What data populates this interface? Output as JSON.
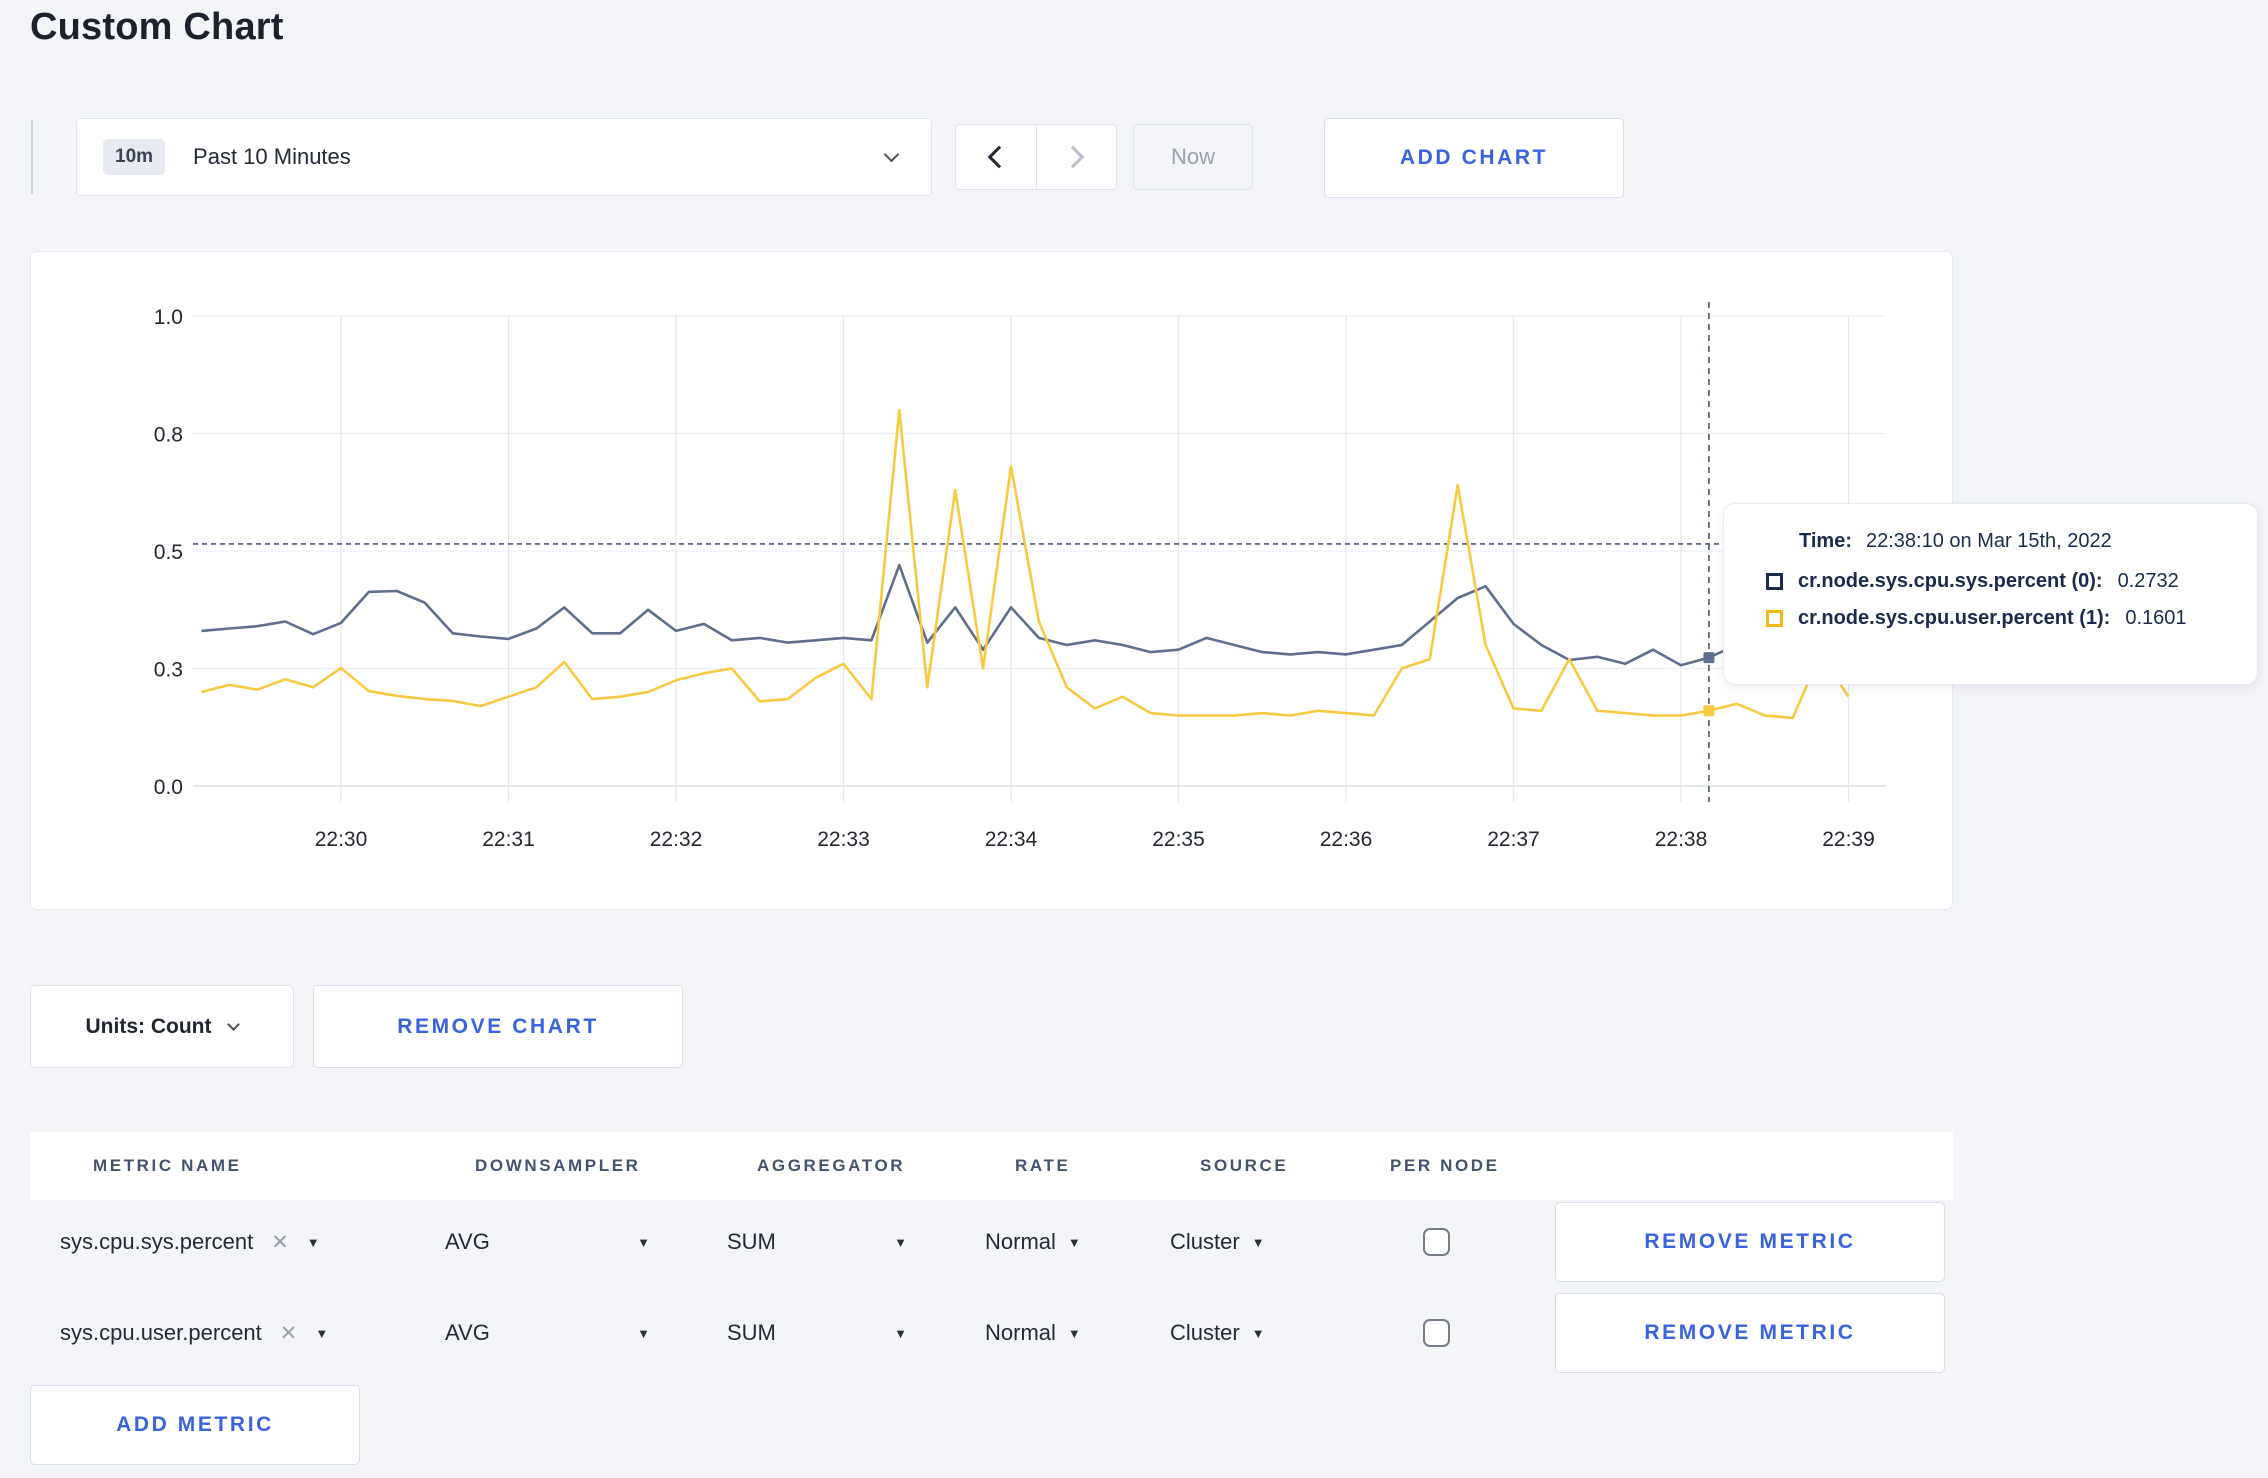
{
  "page": {
    "title": "Custom Chart"
  },
  "toolbar": {
    "range_badge": "10m",
    "range_label": "Past 10 Minutes",
    "now_label": "Now",
    "add_chart_label": "ADD CHART"
  },
  "chart_data": {
    "type": "line",
    "ylim": [
      0,
      1
    ],
    "grid": true,
    "yticks": [
      {
        "label": "0.0",
        "pos": 0
      },
      {
        "label": "0.3",
        "pos": 0.25
      },
      {
        "label": "0.5",
        "pos": 0.5
      },
      {
        "label": "0.8",
        "pos": 0.75
      },
      {
        "label": "1.0",
        "pos": 1
      }
    ],
    "x_axis": {
      "start_tick": "22:30:00",
      "tick_interval_minutes": 1,
      "tick_labels": [
        "22:30",
        "22:31",
        "22:32",
        "22:33",
        "22:34",
        "22:35",
        "22:36",
        "22:37",
        "22:38",
        "22:39"
      ]
    },
    "times": [
      "22:29:10",
      "22:29:20",
      "22:29:30",
      "22:29:40",
      "22:29:50",
      "22:30:00",
      "22:30:10",
      "22:30:20",
      "22:30:30",
      "22:30:40",
      "22:30:50",
      "22:31:00",
      "22:31:10",
      "22:31:20",
      "22:31:30",
      "22:31:40",
      "22:31:50",
      "22:32:00",
      "22:32:10",
      "22:32:20",
      "22:32:30",
      "22:32:40",
      "22:32:50",
      "22:33:00",
      "22:33:10",
      "22:33:20",
      "22:33:30",
      "22:33:40",
      "22:33:50",
      "22:34:00",
      "22:34:10",
      "22:34:20",
      "22:34:30",
      "22:34:40",
      "22:34:50",
      "22:35:00",
      "22:35:10",
      "22:35:20",
      "22:35:30",
      "22:35:40",
      "22:35:50",
      "22:36:00",
      "22:36:10",
      "22:36:20",
      "22:36:30",
      "22:36:40",
      "22:36:50",
      "22:37:00",
      "22:37:10",
      "22:37:20",
      "22:37:30",
      "22:37:40",
      "22:37:50",
      "22:38:00",
      "22:38:10",
      "22:38:20",
      "22:38:30",
      "22:38:40",
      "22:38:50",
      "22:39:00"
    ],
    "series": [
      {
        "name": "cr.node.sys.cpu.sys.percent",
        "node": "(0)",
        "color": "#5f6e8c",
        "values": [
          0.33,
          0.335,
          0.34,
          0.35,
          0.323,
          0.347,
          0.413,
          0.415,
          0.39,
          0.325,
          0.318,
          0.313,
          0.335,
          0.38,
          0.325,
          0.325,
          0.375,
          0.33,
          0.345,
          0.31,
          0.315,
          0.305,
          0.31,
          0.315,
          0.31,
          0.47,
          0.305,
          0.38,
          0.29,
          0.38,
          0.315,
          0.3,
          0.31,
          0.3,
          0.285,
          0.29,
          0.315,
          0.3,
          0.285,
          0.28,
          0.285,
          0.28,
          0.29,
          0.3,
          0.35,
          0.4,
          0.425,
          0.345,
          0.3,
          0.268,
          0.275,
          0.26,
          0.29,
          0.257,
          0.2732,
          0.3,
          0.29,
          0.285,
          0.29,
          0.3
        ]
      },
      {
        "name": "cr.node.sys.cpu.user.percent",
        "node": "(1)",
        "color": "#f8c943",
        "values": [
          0.2,
          0.215,
          0.205,
          0.227,
          0.21,
          0.251,
          0.202,
          0.192,
          0.185,
          0.181,
          0.17,
          0.19,
          0.21,
          0.264,
          0.185,
          0.19,
          0.2,
          0.225,
          0.24,
          0.25,
          0.18,
          0.185,
          0.23,
          0.26,
          0.185,
          0.8,
          0.21,
          0.63,
          0.25,
          0.68,
          0.35,
          0.21,
          0.165,
          0.19,
          0.155,
          0.15,
          0.15,
          0.15,
          0.155,
          0.15,
          0.16,
          0.155,
          0.15,
          0.25,
          0.27,
          0.64,
          0.3,
          0.165,
          0.16,
          0.27,
          0.16,
          0.155,
          0.15,
          0.15,
          0.1601,
          0.175,
          0.15,
          0.145,
          0.28,
          0.19
        ]
      }
    ],
    "crosshair": {
      "time": "22:38:10",
      "hline_frac": 0.515,
      "values": [
        0.2732,
        0.1601
      ]
    }
  },
  "tooltip": {
    "time_label": "Time:",
    "time_value": "22:38:10 on Mar 15th, 2022",
    "series": [
      {
        "name": "cr.node.sys.cpu.sys.percent (0):",
        "value": "0.2732",
        "color": "#1c2b4d"
      },
      {
        "name": "cr.node.sys.cpu.user.percent (1):",
        "value": "0.1601",
        "color": "#f2b818"
      }
    ]
  },
  "units_row": {
    "units_label": "Units: Count",
    "remove_chart_label": "REMOVE CHART"
  },
  "table": {
    "columns": [
      "METRIC NAME",
      "DOWNSAMPLER",
      "AGGREGATOR",
      "RATE",
      "SOURCE",
      "PER NODE"
    ],
    "rows": [
      {
        "metric": "sys.cpu.sys.percent",
        "downsampler": "AVG",
        "aggregator": "SUM",
        "rate": "Normal",
        "source": "Cluster",
        "per_node_checked": false,
        "remove_label": "REMOVE METRIC"
      },
      {
        "metric": "sys.cpu.user.percent",
        "downsampler": "AVG",
        "aggregator": "SUM",
        "rate": "Normal",
        "source": "Cluster",
        "per_node_checked": false,
        "remove_label": "REMOVE METRIC"
      }
    ],
    "add_metric_label": "ADD METRIC"
  }
}
